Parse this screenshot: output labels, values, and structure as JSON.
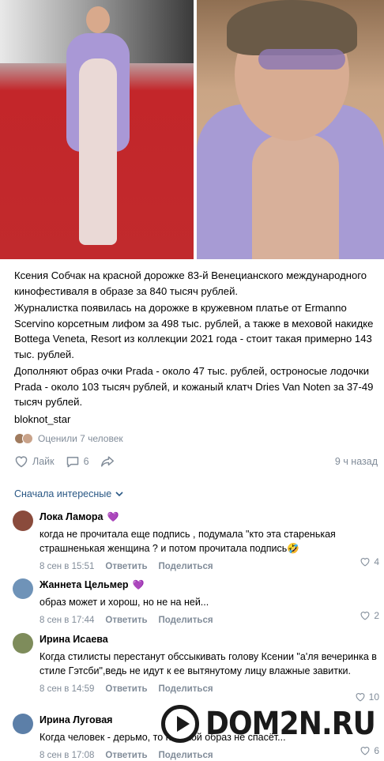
{
  "post": {
    "paragraph1": "Ксения Собчак на красной дорожке 83-й Венецианского международного кинофестиваля в образе за 840 тысяч рублей.",
    "paragraph2": "Журналистка появилась на дорожке в кружевном платье от Ermanno Scervino корсетным лифом за 498 тыс. рублей, а также в меховой накидке Bottega Veneta, Resort из коллекции 2021 года - стоит такая примерно 143 тыс. рублей.",
    "paragraph3": "Дополняют образ очки Prada - около 47 тыс. рублей, остроносые лодочки Prada - около 103 тысяч рублей, и кожаный клатч Dries Van Noten за 37-49 тысяч рублей.",
    "source": "bloknot_star",
    "rated_label": "Оценили 7 человек",
    "like_label": "Лайк",
    "comment_count": "6",
    "posted_time": "9 ч назад",
    "sort_label": "Сначала интересные"
  },
  "comments": [
    {
      "name": "Лока Ламора",
      "text": "когда не прочитала еще подпись , подумала \"кто эта старенькая страшненькая женщина ? и потом прочитала подпись🤣",
      "date": "8 сен в 15:51",
      "reply": "Ответить",
      "share": "Поделиться",
      "likes": "4",
      "avatar_color": "#8a4b3c"
    },
    {
      "name": "Жаннета Цельмер",
      "text": "образ может и хорош, но не на ней...",
      "date": "8 сен в 17:44",
      "reply": "Ответить",
      "share": "Поделиться",
      "likes": "2",
      "avatar_color": "#6f93b8"
    },
    {
      "name": "Ирина Исаева",
      "text": "Когда стилисты перестанут обссыкивать голову Ксении \"а'ля вечеринка в стиле Гэтсби\",ведь не идут к ее вытянутому лицу влажные завитки.",
      "date": "8 сен в 14:59",
      "reply": "Ответить",
      "share": "Поделиться",
      "likes": "10",
      "avatar_color": "#7e8c5b"
    },
    {
      "name": "Ирина Луговая",
      "text": "Когда человек - дерьмо, то никакой образ не спасёт...",
      "date": "8 сен в 17:08",
      "reply": "Ответить",
      "share": "Поделиться",
      "likes": "6",
      "avatar_color": "#5c7fa8"
    }
  ],
  "watermark": "DOM2N.RU",
  "colors": {
    "link": "#2a5885",
    "muted": "#818c99",
    "badge": "#a46ad6"
  }
}
